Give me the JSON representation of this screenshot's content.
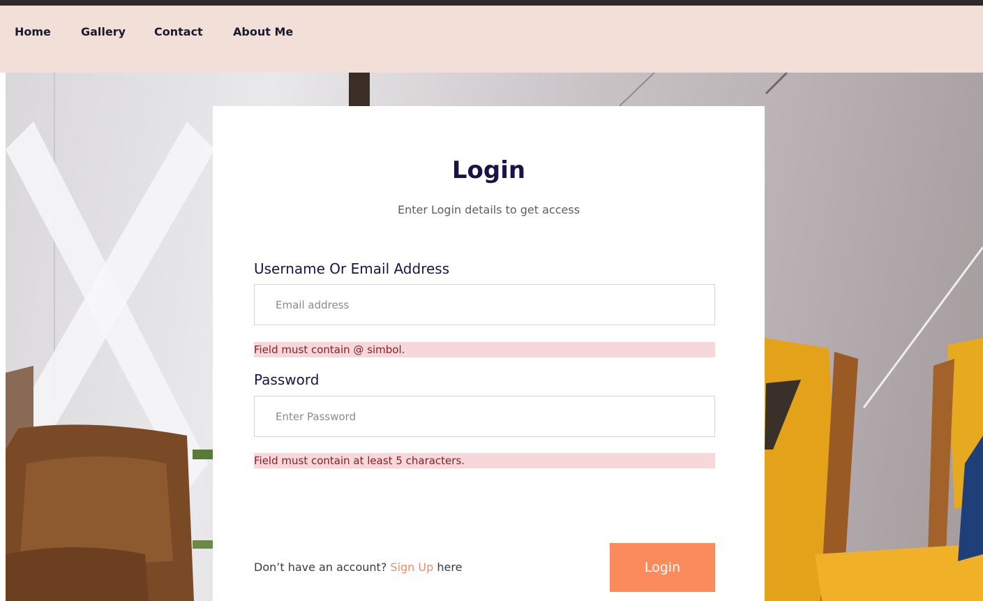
{
  "nav": {
    "items": [
      {
        "label": "Home"
      },
      {
        "label": "Gallery"
      },
      {
        "label": "Contact"
      },
      {
        "label": "About Me"
      }
    ]
  },
  "login": {
    "title": "Login",
    "subtitle": "Enter Login details to get access",
    "username_label": "Username Or Email Address",
    "email_placeholder": "Email address",
    "email_value": "",
    "email_error": "Field must contain @ simbol.",
    "password_label": "Password",
    "password_placeholder": "Enter Password",
    "password_value": "",
    "password_error": "Field must contain at least 5 characters.",
    "signup_prefix": "Don’t have an account?",
    "signup_link": "Sign Up",
    "signup_suffix": "here",
    "submit_label": "Login"
  },
  "colors": {
    "accent": "#fb8a5c",
    "nav_background": "#f2e0d8",
    "heading": "#1b1347",
    "error_background": "#f8d7da"
  }
}
